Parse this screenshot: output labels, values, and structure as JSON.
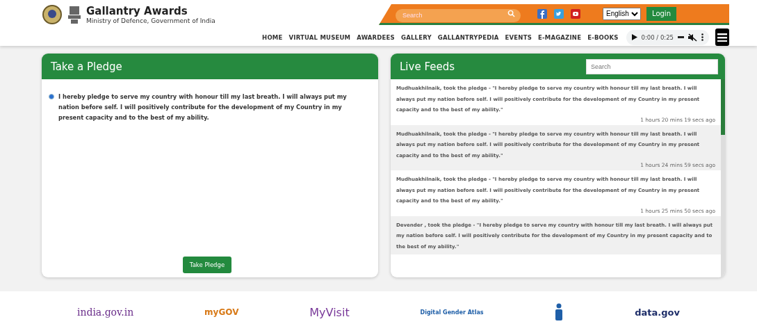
{
  "header": {
    "title": "Gallantry Awards",
    "subtitle": "Ministry of Defence, Government of India",
    "search": {
      "placeholder": "Search"
    },
    "language": "English",
    "login": "Login"
  },
  "nav": [
    "HOME",
    "VIRTUAL MUSEUM",
    "AWARDEES",
    "GALLERY",
    "GALLANTRYPEDIA",
    "EVENTS",
    "E-MAGAZINE",
    "E-BOOKS"
  ],
  "audio": {
    "time": "0:00 / 0:25",
    "muted": true
  },
  "pledge": {
    "title": "Take a Pledge",
    "options": [
      {
        "text": "I hereby pledge to serve my country with honour till my last breath. I will always put my nation before self. I will positively contribute for the development of my Country in my present capacity and to the best of my ability.",
        "selected": true
      }
    ],
    "button": "Take Pledge"
  },
  "feeds": {
    "title": "Live Feeds",
    "search": {
      "placeholder": "Search"
    },
    "items": [
      {
        "text": "Mudhuakhilnaik, took the pledge - \"I hereby pledge to serve my country with honour till my last breath. I will always put my nation before self. I will positively contribute for the development of my Country in my present capacity and to the best of my ability.\"",
        "time": "1 hours 20 mins 19 secs ago"
      },
      {
        "text": "Mudhuakhilnaik, took the pledge - \"I hereby pledge to serve my country with honour till my last breath. I will always put my nation before self. I will positively contribute for the development of my Country in my present capacity and to the best of my ability.\"",
        "time": "1 hours 24 mins 59 secs ago"
      },
      {
        "text": "Mudhuakhilnaik, took the pledge - \"I hereby pledge to serve my country with honour till my last breath. I will always put my nation before self. I will positively contribute for the development of my Country in my present capacity and to the best of my ability.\"",
        "time": "1 hours 25 mins 50 secs ago"
      },
      {
        "text": "Devender , took the pledge - \"I hereby pledge to serve my country with honour till my last breath. I will always put my nation before self. I will positively contribute for the development of my Country in my present capacity and to the best of my ability.\""
      }
    ]
  },
  "footer_logos": [
    {
      "kind": "text",
      "text": "india.gov.in"
    },
    {
      "kind": "text",
      "text": "myGOV"
    },
    {
      "kind": "text",
      "text": "MyVisit"
    },
    {
      "kind": "text",
      "text": "Digital Gender Atlas"
    },
    {
      "kind": "icon"
    },
    {
      "kind": "text",
      "text": "data.gov"
    }
  ]
}
